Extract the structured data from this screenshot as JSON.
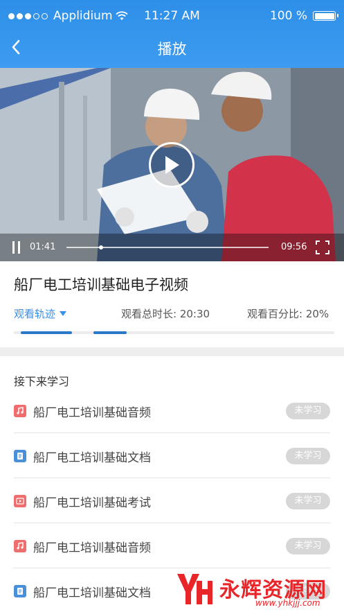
{
  "status_bar": {
    "carrier": "Applidium",
    "time": "11:27 AM",
    "battery": "100 %"
  },
  "nav": {
    "title": "播放"
  },
  "player": {
    "current_time": "01:41",
    "total_time": "09:56",
    "progress": 0.17
  },
  "course": {
    "title": "船厂电工培训基础电子视频",
    "track_label": "观看轨迹",
    "total_duration": "观看总时长: 20:30",
    "percent": "观看百分比: 20%"
  },
  "next": {
    "header": "接下来学习",
    "items": [
      {
        "label": "船厂电工培训基础音频",
        "status": "未学习",
        "icon": "audio-icon",
        "color": "#ef6d6d"
      },
      {
        "label": "船厂电工培训基础文档",
        "status": "未学习",
        "icon": "document-icon",
        "color": "#4a90d9"
      },
      {
        "label": "船厂电工培训基础考试",
        "status": "未学习",
        "icon": "exam-icon",
        "color": "#ef6d6d"
      },
      {
        "label": "船厂电工培训基础音频",
        "status": "未学习",
        "icon": "audio-icon",
        "color": "#ef6d6d"
      },
      {
        "label": "船厂电工培训基础文档",
        "status": "未学习",
        "icon": "document-icon",
        "color": "#4a90d9"
      }
    ]
  },
  "watermark": {
    "brand": "永辉资源网",
    "url": "www.yhkjjj.com"
  },
  "colors": {
    "accent": "#3a8ee6",
    "header": "#2e8fe8",
    "badge": "#d7d7d7"
  }
}
